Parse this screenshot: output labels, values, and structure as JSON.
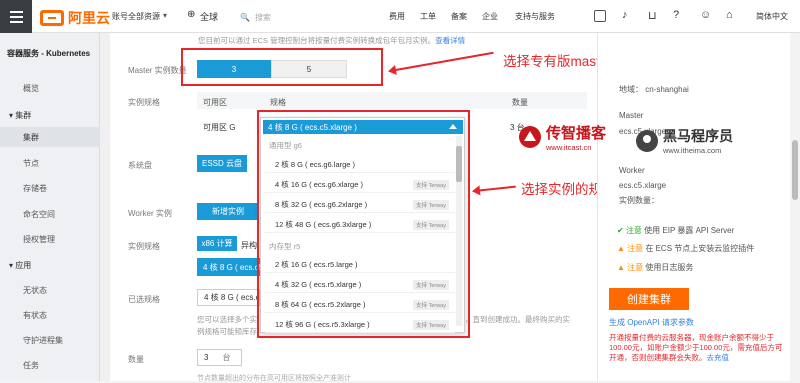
{
  "topbar": {
    "logo_text": "阿里云",
    "account": "账号全部资源",
    "region": "全球",
    "search_placeholder": "搜索",
    "links": [
      "费用",
      "工单",
      "备案",
      "企业",
      "支持与服务"
    ],
    "language": "简体中文"
  },
  "sidebar": {
    "title": "容器服务 - Kubernetes",
    "items": [
      {
        "label": "概览",
        "group": false
      },
      {
        "label": "集群",
        "group": true
      },
      {
        "label": "集群",
        "group": false,
        "active": true
      },
      {
        "label": "节点",
        "group": false
      },
      {
        "label": "存储卷",
        "group": false
      },
      {
        "label": "命名空间",
        "group": false
      },
      {
        "label": "授权管理",
        "group": false
      },
      {
        "label": "应用",
        "group": true
      },
      {
        "label": "无状态",
        "group": false
      },
      {
        "label": "有状态",
        "group": false
      },
      {
        "label": "守护进程集",
        "group": false
      },
      {
        "label": "任务",
        "group": false
      }
    ]
  },
  "main": {
    "notice_text": "您目前可以通过 ECS 管理控制台将按量付费实例转换成包年包月实例。",
    "notice_link": "查看详情",
    "master_count_label": "Master 实例数量",
    "master_count_options": [
      "3",
      "5"
    ],
    "instance_spec_label": "实例规格",
    "table_headers": [
      "可用区",
      "规格",
      "数量"
    ],
    "zone_value": "可用区 G",
    "qty_value": "3 台",
    "system_disk_label": "系统盘",
    "system_disk_value": "ESSD 云盘",
    "worker_label": "Worker 实例",
    "worker_value": "新增实例",
    "worker_spec_label": "实例规格",
    "arch_value": "x86 计算",
    "arch_next": "异构",
    "worker_spec_value": "4 核 8 G ( ecs.c5",
    "selected_spec_label": "已选规格",
    "selected_spec_value": "4 核 8 G ( ecs.c5",
    "help_line1": "您可以选择多个实",
    "help_line2": "例规格可能频库存",
    "help_tail": "，直到创建成功。最终购买的实",
    "count_label": "数量",
    "count_value": "3",
    "count_unit": "台",
    "footer_cut": "节点数量超出的分布在高可用区将按照全产准则计"
  },
  "dropdown": {
    "selected": "4 核 8 G ( ecs.c5.xlarge )",
    "groups": [
      {
        "name": "通用型 g6",
        "options": [
          {
            "label": "2 核 8 G ( ecs.g6.large )",
            "tag": ""
          },
          {
            "label": "4 核 16 G ( ecs.g6.xlarge )",
            "tag": "支持 Terway"
          },
          {
            "label": "8 核 32 G ( ecs.g6.2xlarge )",
            "tag": "支持 Terway"
          },
          {
            "label": "12 核 48 G ( ecs.g6.3xlarge )",
            "tag": "支持 Terway"
          }
        ]
      },
      {
        "name": "内存型 r5",
        "options": [
          {
            "label": "2 核 16 G ( ecs.r5.large )",
            "tag": ""
          },
          {
            "label": "4 核 32 G ( ecs.r5.xlarge )",
            "tag": "支持 Terway"
          },
          {
            "label": "8 核 64 G ( ecs.r5.2xlarge )",
            "tag": "支持 Terway"
          },
          {
            "label": "12 核 96 G ( ecs.r5.3xlarge )",
            "tag": "支持 Terway"
          }
        ]
      }
    ]
  },
  "annotations": {
    "top": "选择专有版master数量",
    "middle": "选择实例的规格默认是4核8G"
  },
  "watermarks": {
    "itcast_name": "传智播客",
    "itcast_url": "www.itcast.cn",
    "itheima_name": "黑马程序员",
    "itheima_url": "www.itheima.com"
  },
  "right_panel": {
    "region_label": "地域：",
    "region_value": "cn-shanghai",
    "master_label": "Master",
    "master_value": "ecs.c5.xlarge",
    "worker_label": "Worker",
    "worker_value": "ecs.c5.xlarge",
    "worker_count": "实例数量：",
    "items": [
      {
        "status": "注意",
        "text": "使用 EIP 暴露 API Server",
        "kind": "ok"
      },
      {
        "status": "注意",
        "text": "在 ECS 节点上安装云监控插件",
        "kind": "warn"
      },
      {
        "status": "注意",
        "text": "使用日志服务",
        "kind": "warn"
      }
    ],
    "create_button": "创建集群",
    "openapi_link": "生成 OpenAPI 请求参数",
    "warning_text": "开通按量付费的云服务器，现金账户余额不得少于 100.00元，如账户金额少于100.00元，需充值后方可开通，否则创建集群会失败。",
    "recharge_link": "去充值"
  },
  "colors": {
    "accent": "#1b9ad8",
    "brand": "#ff6a00",
    "annotation": "#e5262a"
  }
}
